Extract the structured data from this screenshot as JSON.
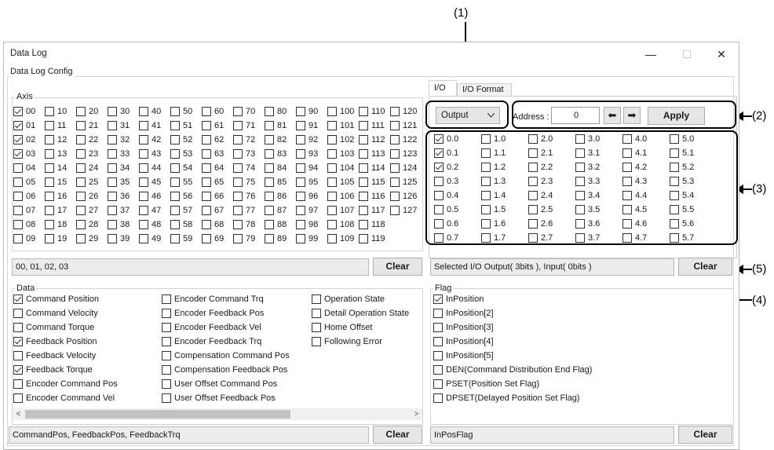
{
  "callouts": [
    "(1)",
    "(2)",
    "(3)",
    "(4)",
    "(5)"
  ],
  "window": {
    "title": "Data Log",
    "minimize_glyph": "—",
    "maximize_glyph": "☐",
    "close_glyph": "✕"
  },
  "config_group_label": "Data Log Config",
  "axis": {
    "label": "Axis",
    "items": [
      [
        "00",
        "10",
        "20",
        "30",
        "40",
        "50",
        "60",
        "70",
        "80",
        "90",
        "100",
        "110",
        "120"
      ],
      [
        "01",
        "11",
        "21",
        "31",
        "41",
        "51",
        "61",
        "71",
        "81",
        "91",
        "101",
        "111",
        "121"
      ],
      [
        "02",
        "12",
        "22",
        "32",
        "42",
        "52",
        "62",
        "72",
        "82",
        "92",
        "102",
        "112",
        "122"
      ],
      [
        "03",
        "13",
        "23",
        "33",
        "43",
        "53",
        "63",
        "73",
        "83",
        "93",
        "103",
        "113",
        "123"
      ],
      [
        "04",
        "14",
        "24",
        "34",
        "44",
        "54",
        "64",
        "74",
        "84",
        "94",
        "104",
        "114",
        "124"
      ],
      [
        "05",
        "15",
        "25",
        "35",
        "45",
        "55",
        "65",
        "75",
        "85",
        "95",
        "105",
        "115",
        "125"
      ],
      [
        "06",
        "16",
        "26",
        "36",
        "46",
        "56",
        "66",
        "76",
        "86",
        "96",
        "106",
        "116",
        "126"
      ],
      [
        "07",
        "17",
        "27",
        "37",
        "47",
        "57",
        "67",
        "77",
        "87",
        "97",
        "107",
        "117",
        "127"
      ],
      [
        "08",
        "18",
        "28",
        "38",
        "48",
        "58",
        "68",
        "78",
        "88",
        "98",
        "108",
        "118"
      ],
      [
        "09",
        "19",
        "29",
        "39",
        "49",
        "59",
        "69",
        "79",
        "89",
        "99",
        "109",
        "119"
      ]
    ],
    "checked": [
      "00",
      "01",
      "02",
      "03"
    ],
    "summary": "00, 01, 02, 03",
    "clear_label": "Clear"
  },
  "data": {
    "label": "Data",
    "columns": [
      [
        {
          "label": "Command Position",
          "checked": true
        },
        {
          "label": "Command Velocity",
          "checked": false
        },
        {
          "label": "Command Torque",
          "checked": false
        },
        {
          "label": "Feedback Position",
          "checked": true
        },
        {
          "label": "Feedback Velocity",
          "checked": false
        },
        {
          "label": "Feedback Torque",
          "checked": true
        },
        {
          "label": "Encoder Command Pos",
          "checked": false
        },
        {
          "label": "Encoder Command Vel",
          "checked": false
        }
      ],
      [
        {
          "label": "Encoder Command Trq",
          "checked": false
        },
        {
          "label": "Encoder Feedback Pos",
          "checked": false
        },
        {
          "label": "Encoder Feedback Vel",
          "checked": false
        },
        {
          "label": "Encoder Feedback Trq",
          "checked": false
        },
        {
          "label": "Compensation Command Pos",
          "checked": false
        },
        {
          "label": "Compensation Feedback Pos",
          "checked": false
        },
        {
          "label": "User Offset Command Pos",
          "checked": false
        },
        {
          "label": "User Offset Feedback Pos",
          "checked": false
        }
      ],
      [
        {
          "label": "Operation State",
          "checked": false
        },
        {
          "label": "Detail Operation State",
          "checked": false
        },
        {
          "label": "Home Offset",
          "checked": false
        },
        {
          "label": "Following Error",
          "checked": false
        }
      ]
    ],
    "summary": "CommandPos, FeedbackPos, FeedbackTrq",
    "clear_label": "Clear",
    "scroll_left": "<",
    "scroll_right": ">"
  },
  "io": {
    "tabs": [
      "I/O",
      "I/O Format"
    ],
    "direction": "Output",
    "address_label": "Address :",
    "address_value": "0",
    "prev_arrow": "⬅",
    "next_arrow": "➡",
    "apply_label": "Apply",
    "bits": [
      [
        "0.0",
        "0.1",
        "0.2",
        "0.3",
        "0.4",
        "0.5",
        "0.6",
        "0.7"
      ],
      [
        "1.0",
        "1.1",
        "1.2",
        "1.3",
        "1.4",
        "1.5",
        "1.6",
        "1.7"
      ],
      [
        "2.0",
        "2.1",
        "2.2",
        "2.3",
        "2.4",
        "2.5",
        "2.6",
        "2.7"
      ],
      [
        "3.0",
        "3.1",
        "3.2",
        "3.3",
        "3.4",
        "3.5",
        "3.6",
        "3.7"
      ],
      [
        "4.0",
        "4.1",
        "4.2",
        "4.3",
        "4.4",
        "4.5",
        "4.6",
        "4.7"
      ],
      [
        "5.0",
        "5.1",
        "5.2",
        "5.3",
        "5.4",
        "5.5",
        "5.6",
        "5.7"
      ]
    ],
    "checked": [
      "0.0",
      "0.1",
      "0.2"
    ],
    "summary": "Selected I/O Output( 3bits ), Input( 0bits )",
    "clear_label": "Clear"
  },
  "flag": {
    "label": "Flag",
    "items": [
      {
        "label": "InPosition",
        "checked": true
      },
      {
        "label": "InPosition[2]",
        "checked": false
      },
      {
        "label": "InPosition[3]",
        "checked": false
      },
      {
        "label": "InPosition[4]",
        "checked": false
      },
      {
        "label": "InPosition[5]",
        "checked": false
      },
      {
        "label": "DEN(Command Distribution End Flag)",
        "checked": false
      },
      {
        "label": "PSET(Position Set Flag)",
        "checked": false
      },
      {
        "label": "DPSET(Delayed Position Set Flag)",
        "checked": false
      }
    ],
    "summary": "InPosFlag",
    "clear_label": "Clear"
  }
}
